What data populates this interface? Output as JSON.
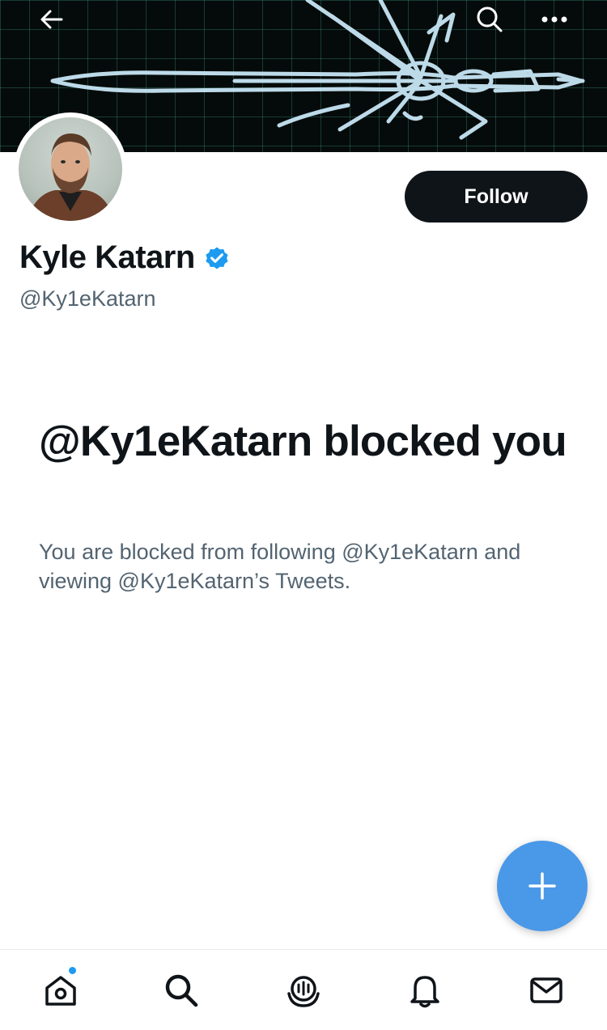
{
  "header": {
    "back_icon": "arrow-left-icon",
    "search_icon": "search-icon",
    "more_icon": "more-horizontal-icon"
  },
  "profile": {
    "display_name": "Kyle Katarn",
    "verified": true,
    "handle": "@Ky1eKatarn",
    "follow_label": "Follow"
  },
  "blocked": {
    "title": "@Ky1eKatarn blocked you",
    "description": "You are blocked from following @Ky1eKatarn and viewing @Ky1eKatarn’s Tweets."
  },
  "fab": {
    "icon": "plus-icon"
  },
  "bottom_nav": {
    "items": [
      {
        "icon": "home-icon",
        "has_notification_dot": true
      },
      {
        "icon": "search-icon"
      },
      {
        "icon": "spaces-icon"
      },
      {
        "icon": "bell-icon"
      },
      {
        "icon": "mail-icon"
      }
    ]
  },
  "colors": {
    "primary_text": "#0f1419",
    "secondary_text": "#536471",
    "accent": "#1d9bf0",
    "fab": "#4a98e8",
    "banner_bg": "#050b0a",
    "banner_lines": "#bfe3f2"
  }
}
